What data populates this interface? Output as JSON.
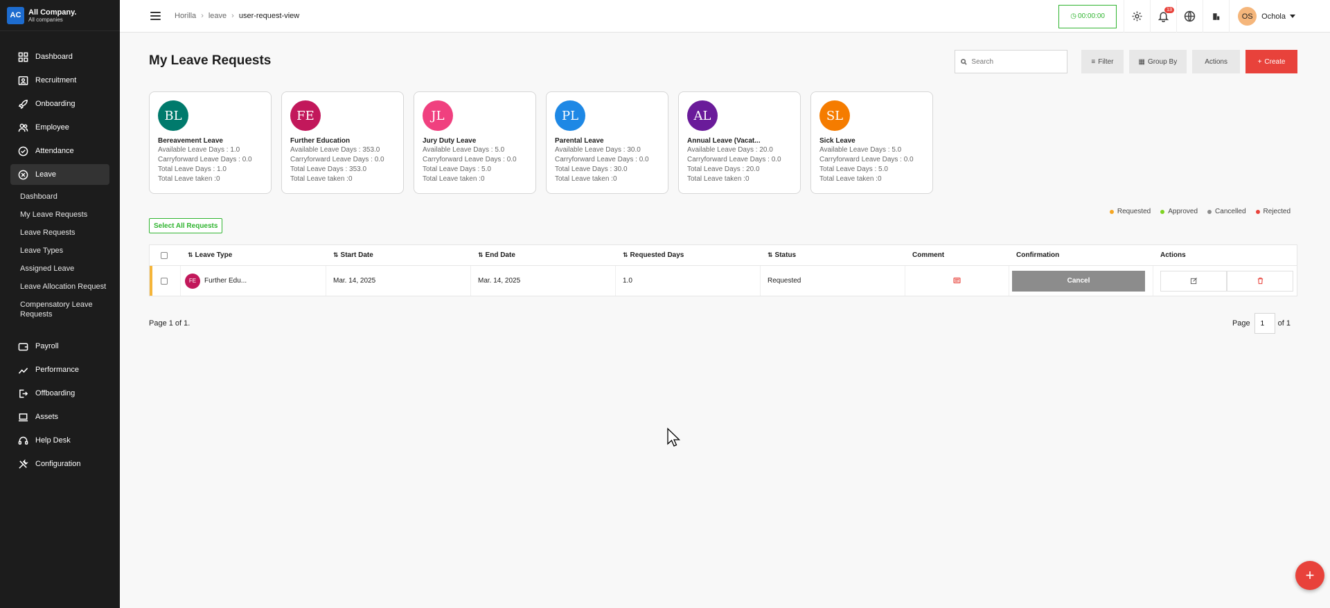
{
  "company": {
    "logo": "AC",
    "name": "All Company.",
    "sub": "All companies"
  },
  "sidebar": {
    "items": [
      {
        "label": "Dashboard",
        "icon": "dashboard-icon"
      },
      {
        "label": "Recruitment",
        "icon": "recruitment-icon"
      },
      {
        "label": "Onboarding",
        "icon": "rocket-icon"
      },
      {
        "label": "Employee",
        "icon": "people-icon"
      },
      {
        "label": "Attendance",
        "icon": "check-circle-icon"
      },
      {
        "label": "Leave",
        "icon": "leave-icon",
        "active": true
      }
    ],
    "leave_sub": [
      "Dashboard",
      "My Leave Requests",
      "Leave Requests",
      "Leave Types",
      "Assigned Leave",
      "Leave Allocation Request",
      "Compensatory Leave Requests"
    ],
    "items_after": [
      {
        "label": "Payroll",
        "icon": "wallet-icon"
      },
      {
        "label": "Performance",
        "icon": "trend-icon"
      },
      {
        "label": "Offboarding",
        "icon": "exit-icon"
      },
      {
        "label": "Assets",
        "icon": "laptop-icon"
      },
      {
        "label": "Help Desk",
        "icon": "headset-icon"
      },
      {
        "label": "Configuration",
        "icon": "tools-icon"
      }
    ]
  },
  "header": {
    "breadcrumb": [
      "Horilla",
      "leave",
      "user-request-view"
    ],
    "timer": "00:00:00",
    "notifications": "13",
    "user_initials": "OS",
    "user_name": "Ochola"
  },
  "page": {
    "title": "My Leave Requests",
    "search_placeholder": "Search",
    "filter_label": "Filter",
    "groupby_label": "Group By",
    "actions_label": "Actions",
    "create_label": "Create",
    "select_all_label": "Select All Requests"
  },
  "labels": {
    "available": "Available Leave Days : ",
    "carryforward": "Carryforward Leave Days : ",
    "total": "Total Leave Days : ",
    "taken": "Total Leave taken :"
  },
  "leave_cards": [
    {
      "initials": "BL",
      "color": "#007a6c",
      "title": "Bereavement Leave",
      "available": "1.0",
      "carryforward": "0.0",
      "total": "1.0",
      "taken": "0"
    },
    {
      "initials": "FE",
      "color": "#c2185b",
      "title": "Further Education",
      "available": "353.0",
      "carryforward": "0.0",
      "total": "353.0",
      "taken": "0"
    },
    {
      "initials": "JL",
      "color": "#f0407f",
      "title": "Jury Duty Leave",
      "available": "5.0",
      "carryforward": "0.0",
      "total": "5.0",
      "taken": "0"
    },
    {
      "initials": "PL",
      "color": "#1e88e5",
      "title": "Parental Leave",
      "available": "30.0",
      "carryforward": "0.0",
      "total": "30.0",
      "taken": "0"
    },
    {
      "initials": "AL",
      "color": "#6a1b9a",
      "title": "Annual Leave (Vacat...",
      "available": "20.0",
      "carryforward": "0.0",
      "total": "20.0",
      "taken": "0"
    },
    {
      "initials": "SL",
      "color": "#f57c00",
      "title": "Sick Leave",
      "available": "5.0",
      "carryforward": "0.0",
      "total": "5.0",
      "taken": "0"
    }
  ],
  "legend": [
    {
      "label": "Requested",
      "color": "#f5a623"
    },
    {
      "label": "Approved",
      "color": "#7ed321"
    },
    {
      "label": "Cancelled",
      "color": "#8c8c8c"
    },
    {
      "label": "Rejected",
      "color": "#e8423b"
    }
  ],
  "table": {
    "headers": {
      "leave_type": "Leave Type",
      "start_date": "Start Date",
      "end_date": "End Date",
      "requested_days": "Requested Days",
      "status": "Status",
      "comment": "Comment",
      "confirmation": "Confirmation",
      "actions": "Actions"
    },
    "rows": [
      {
        "initials": "FE",
        "leave_type": "Further Edu...",
        "start_date": "Mar. 14, 2025",
        "end_date": "Mar. 14, 2025",
        "requested_days": "1.0",
        "status": "Requested",
        "cancel_label": "Cancel"
      }
    ]
  },
  "pagination": {
    "summary": "Page 1 of 1.",
    "page_label": "Page",
    "page_value": "1",
    "of_label": "of 1"
  },
  "colors": {
    "accent": "#e8423b",
    "success": "#2fb42f",
    "sidebar_bg": "#1c1c1c"
  }
}
